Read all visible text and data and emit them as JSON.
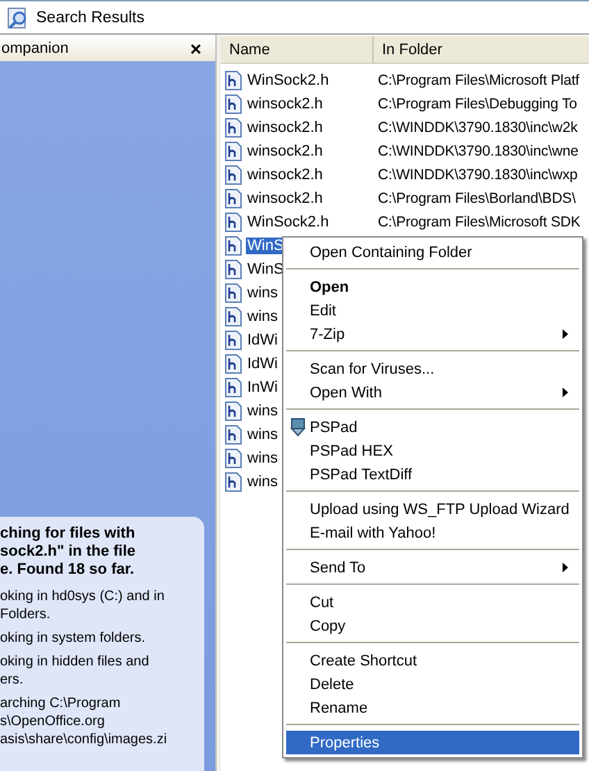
{
  "address_bar": {
    "title": "Search Results"
  },
  "companion": {
    "title": "ompanion",
    "close": "×",
    "status": {
      "heading_lines": [
        "ching for files with",
        "sock2.h\" in the file",
        "e.  Found 18 so far."
      ],
      "notes": [
        {
          "lines": [
            "oking in hd0sys (C:) and in",
            "Folders."
          ]
        },
        {
          "lines": [
            "oking in system folders."
          ]
        },
        {
          "lines": [
            "oking in hidden files and",
            "ers."
          ]
        },
        {
          "lines": [
            "arching C:\\Program",
            "s\\OpenOffice.org",
            "asis\\share\\config\\images.zi"
          ]
        }
      ]
    }
  },
  "results": {
    "columns": [
      "Name",
      "In Folder"
    ],
    "rows": [
      {
        "name": "WinSock2.h",
        "folder": "C:\\Program Files\\Microsoft Platf",
        "selected": false
      },
      {
        "name": "winsock2.h",
        "folder": "C:\\Program Files\\Debugging To",
        "selected": false
      },
      {
        "name": "winsock2.h",
        "folder": "C:\\WINDDK\\3790.1830\\inc\\w2k",
        "selected": false
      },
      {
        "name": "winsock2.h",
        "folder": "C:\\WINDDK\\3790.1830\\inc\\wne",
        "selected": false
      },
      {
        "name": "winsock2.h",
        "folder": "C:\\WINDDK\\3790.1830\\inc\\wxp",
        "selected": false
      },
      {
        "name": "winsock2.h",
        "folder": "C:\\Program Files\\Borland\\BDS\\",
        "selected": false
      },
      {
        "name": "WinSock2.h",
        "folder": "C:\\Program Files\\Microsoft SDK",
        "selected": false
      },
      {
        "name": "WinS",
        "selected": true
      },
      {
        "name": "WinS",
        "selected": false
      },
      {
        "name": "wins",
        "selected": false
      },
      {
        "name": "wins",
        "selected": false
      },
      {
        "name": "IdWi",
        "selected": false
      },
      {
        "name": "IdWi",
        "selected": false
      },
      {
        "name": "InWi",
        "selected": false
      },
      {
        "name": "wins",
        "selected": false
      },
      {
        "name": "wins",
        "selected": false
      },
      {
        "name": "wins",
        "selected": false
      },
      {
        "name": "wins",
        "selected": false
      }
    ]
  },
  "context_menu": {
    "items": [
      {
        "kind": "item",
        "label": "Open Containing Folder",
        "bold": false,
        "submenu": false,
        "has_icon": false,
        "selected": false
      },
      {
        "kind": "separator"
      },
      {
        "kind": "item",
        "label": "Open",
        "bold": true,
        "submenu": false,
        "has_icon": false,
        "selected": false
      },
      {
        "kind": "item",
        "label": "Edit",
        "bold": false,
        "submenu": false,
        "has_icon": false,
        "selected": false
      },
      {
        "kind": "item",
        "label": "7-Zip",
        "bold": false,
        "submenu": true,
        "has_icon": false,
        "selected": false
      },
      {
        "kind": "separator"
      },
      {
        "kind": "item",
        "label": "Scan for Viruses...",
        "bold": false,
        "submenu": false,
        "has_icon": false,
        "selected": false
      },
      {
        "kind": "item",
        "label": "Open With",
        "bold": false,
        "submenu": true,
        "has_icon": false,
        "selected": false
      },
      {
        "kind": "separator"
      },
      {
        "kind": "item",
        "label": "PSPad",
        "bold": false,
        "submenu": false,
        "has_icon": true,
        "selected": false
      },
      {
        "kind": "item",
        "label": "PSPad HEX",
        "bold": false,
        "submenu": false,
        "has_icon": false,
        "selected": false
      },
      {
        "kind": "item",
        "label": "PSPad TextDiff",
        "bold": false,
        "submenu": false,
        "has_icon": false,
        "selected": false
      },
      {
        "kind": "separator"
      },
      {
        "kind": "item",
        "label": "Upload using WS_FTP Upload Wizard",
        "bold": false,
        "submenu": false,
        "has_icon": false,
        "selected": false
      },
      {
        "kind": "item",
        "label": "E-mail with Yahoo!",
        "bold": false,
        "submenu": false,
        "has_icon": false,
        "selected": false
      },
      {
        "kind": "separator"
      },
      {
        "kind": "item",
        "label": "Send To",
        "bold": false,
        "submenu": true,
        "has_icon": false,
        "selected": false
      },
      {
        "kind": "separator"
      },
      {
        "kind": "item",
        "label": "Cut",
        "bold": false,
        "submenu": false,
        "has_icon": false,
        "selected": false
      },
      {
        "kind": "item",
        "label": "Copy",
        "bold": false,
        "submenu": false,
        "has_icon": false,
        "selected": false
      },
      {
        "kind": "separator"
      },
      {
        "kind": "item",
        "label": "Create Shortcut",
        "bold": false,
        "submenu": false,
        "has_icon": false,
        "selected": false
      },
      {
        "kind": "item",
        "label": "Delete",
        "bold": false,
        "submenu": false,
        "has_icon": false,
        "selected": false
      },
      {
        "kind": "item",
        "label": "Rename",
        "bold": false,
        "submenu": false,
        "has_icon": false,
        "selected": false
      },
      {
        "kind": "separator"
      },
      {
        "kind": "item",
        "label": "Properties",
        "bold": false,
        "submenu": false,
        "has_icon": false,
        "selected": true
      }
    ]
  }
}
